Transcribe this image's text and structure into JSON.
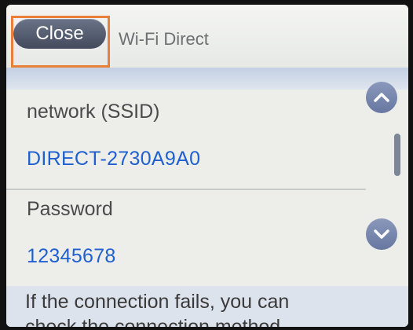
{
  "header": {
    "close_label": "Close",
    "title": "Wi-Fi Direct"
  },
  "network": {
    "ssid_label": "network (SSID)",
    "ssid_value": "DIRECT-2730A9A0",
    "password_label": "Password",
    "password_value": "12345678"
  },
  "scroll": {
    "up_icon": "chevron-up-icon",
    "down_icon": "chevron-down-icon"
  },
  "footer": {
    "message_line1": "If the connection fails, you can",
    "message_line2": "check the connection method"
  },
  "colors": {
    "accent_value": "#1f5fd0",
    "highlight": "#e8803a",
    "button": "#4f586b"
  }
}
